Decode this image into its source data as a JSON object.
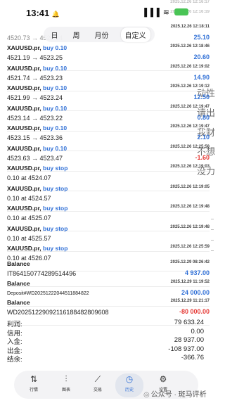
{
  "status_bar": {
    "time": "13:41",
    "bell": "🔔",
    "signal": "▐▐▐ ≋",
    "battery_icon": "battery-charging-icon"
  },
  "periods": [
    "日",
    "周",
    "月份",
    "自定义"
  ],
  "active_period": "自定义",
  "peek": [
    {
      "time": "2025.12.26 12:16:17"
    },
    {
      "time": "2025.12.26 12:16:19"
    },
    {
      "desc": "4520.73 → 4520.24",
      "time": "2025.12.26 12:18:11",
      "value": "25.10",
      "value_color": "#2f6fd6"
    }
  ],
  "orders": [
    {
      "symbol": "XAUUSD.pr,",
      "action": "buy 0.10",
      "desc": "4521.19 → 4523.25",
      "time": "2025.12.26 12:18:46",
      "value": "20.60",
      "value_color": "#2f6fd6"
    },
    {
      "symbol": "XAUUSD.pr,",
      "action": "buy 0.10",
      "desc": "4521.74 → 4523.23",
      "time": "2025.12.26 12:19:02",
      "value": "14.90",
      "value_color": "#2f6fd6"
    },
    {
      "symbol": "XAUUSD.pr,",
      "action": "buy 0.10",
      "desc": "4521.99 → 4523.24",
      "time": "2025.12.26 12:19:12",
      "value": "12.50",
      "value_color": "#2f6fd6"
    },
    {
      "symbol": "XAUUSD.pr,",
      "action": "buy 0.10",
      "desc": "4523.14 → 4523.22",
      "time": "2025.12.26 12:19:47",
      "value": "0.80",
      "value_color": "#2f6fd6"
    },
    {
      "symbol": "XAUUSD.pr,",
      "action": "buy 0.10",
      "desc": "4523.15 → 4523.36",
      "time": "2025.12.26 12:19:47",
      "value": "2.10",
      "value_color": "#2f6fd6"
    },
    {
      "symbol": "XAUUSD.pr,",
      "action": "buy 0.10",
      "desc": "4523.63 → 4523.47",
      "time": "2025.12.26 12:25:58",
      "value": "-1.60",
      "value_color": "#e53935"
    },
    {
      "symbol": "XAUUSD.pr,",
      "action": "buy stop",
      "desc": "0.10 at 4524.07",
      "time": "2025.12.26 12:19:03",
      "value": "",
      "value_color": "#2f6fd6"
    },
    {
      "symbol": "XAUUSD.pr,",
      "action": "buy stop",
      "desc": "0.10 at 4524.57",
      "time": "2025.12.26 12:19:05",
      "value": "",
      "value_color": "#2f6fd6"
    },
    {
      "symbol": "XAUUSD.pr,",
      "action": "buy stop",
      "desc": "0.10 at 4525.07",
      "time": "2025.12.26 12:19:48",
      "value": "",
      "value_color": "#2f6fd6"
    },
    {
      "symbol": "XAUUSD.pr,",
      "action": "buy stop",
      "desc": "0.10 at 4525.57",
      "time": "2025.12.26 12:19:48",
      "value": "",
      "value_color": "#2f6fd6"
    },
    {
      "symbol": "XAUUSD.pr,",
      "action": "buy stop",
      "desc": "0.10 at 4526.07",
      "time": "2025.12.26 12:25:59",
      "value": "",
      "value_color": "#2f6fd6"
    }
  ],
  "balances": [
    {
      "title": "Balance",
      "desc": "IT864150774289514496",
      "time": "2025.12.29 08:26:42",
      "value": "4 937.00",
      "value_color": "#2f6fd6",
      "small": false
    },
    {
      "title": "Balance",
      "desc": "Deposit#WD20251222044511884822",
      "time": "2025.12.29 11:19:52",
      "value": "24 000.00",
      "value_color": "#2f6fd6",
      "small": true
    },
    {
      "title": "Balance",
      "desc": "WD20251229092116188482809608",
      "time": "2025.12.29 11:21:17",
      "value": "-80 000.00",
      "value_color": "#e53935",
      "small": false
    }
  ],
  "summary": [
    {
      "label": "利润:",
      "value": "79 633.24"
    },
    {
      "label": "信用:",
      "value": "0.00"
    },
    {
      "label": "入金:",
      "value": "28 937.00"
    },
    {
      "label": "出金:",
      "value": "-108 937.00"
    },
    {
      "label": "结余:",
      "value": "-366.76"
    }
  ],
  "tabs": [
    {
      "label": "行情",
      "glyph": "⇅",
      "icon": "quotes-icon"
    },
    {
      "label": "图表",
      "glyph": "⫶",
      "icon": "chart-icon"
    },
    {
      "label": "交易",
      "glyph": "⟋",
      "icon": "trade-icon"
    },
    {
      "label": "历史",
      "glyph": "◷",
      "icon": "history-icon"
    },
    {
      "label": "设置",
      "glyph": "⚙",
      "icon": "gear-icon"
    }
  ],
  "active_tab": "历史",
  "background_text": [
    "动性",
    "请出",
    "我财",
    "不想",
    "没力"
  ],
  "watermark": "公众号 · 斑马评析"
}
